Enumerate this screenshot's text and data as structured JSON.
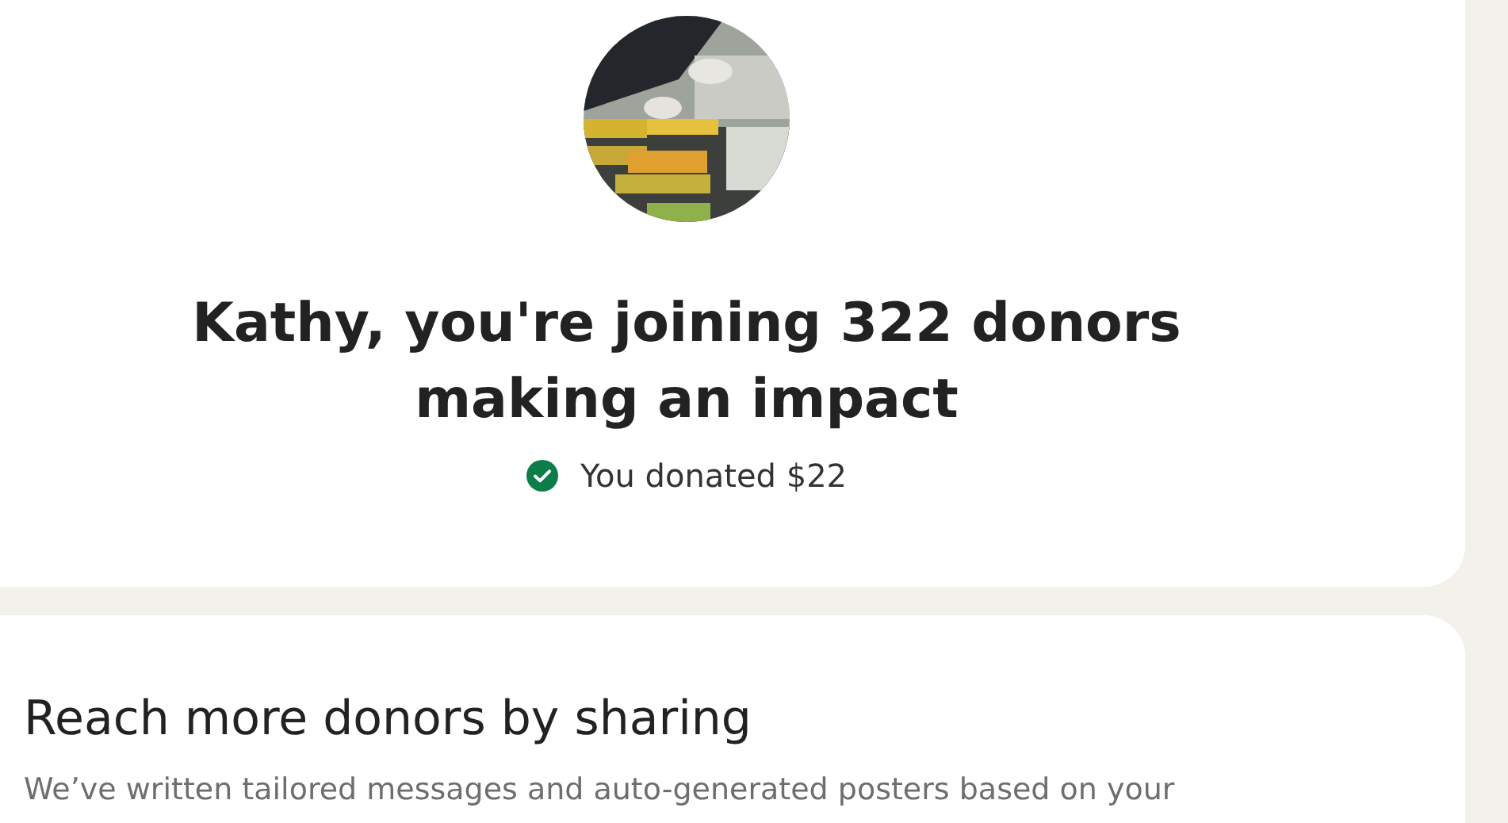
{
  "confirmation": {
    "title": "Kathy, you're joining 322 donors making an impact",
    "status": {
      "kind": "done",
      "text": "You donated $22"
    }
  },
  "share": {
    "heading": "Reach more donors by sharing",
    "description": "We’ve written tailored messages and auto-generated posters based on your"
  }
}
